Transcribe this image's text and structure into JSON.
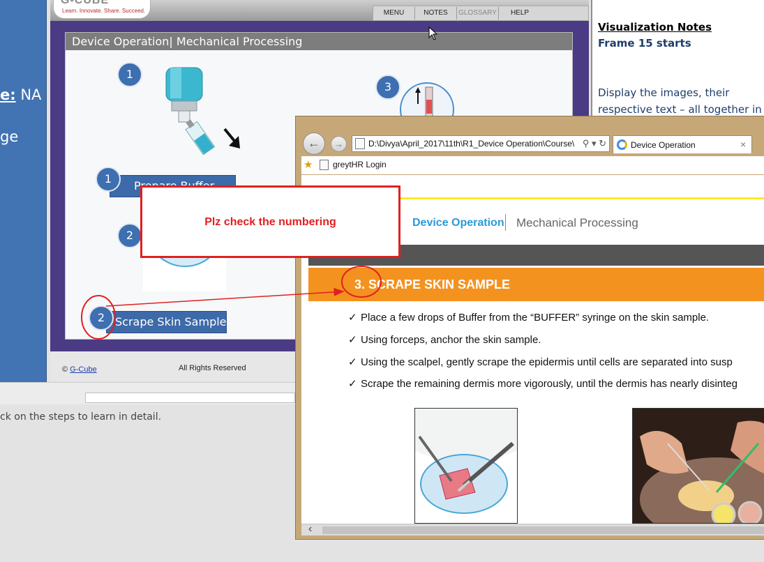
{
  "left_panel": {
    "label_partial": "e:",
    "value": "NA",
    "text_partial": "ge"
  },
  "instruction": "ck on the steps to learn in detail.",
  "course": {
    "logo_text": "G-CUBE",
    "tagline": "Learn. Innovate. Share. Succeed.",
    "nav": {
      "menu": "MENU",
      "notes": "NOTES",
      "glossary": "GLOSSARY",
      "help": "HELP"
    },
    "slide_title": "Device Operation| Mechanical Processing",
    "steps": [
      {
        "number": "1",
        "label": "Prepare Buffer"
      },
      {
        "number": "2",
        "label": "Scrape Skin Sample"
      }
    ],
    "image_numbers": [
      "1",
      "2",
      "3"
    ],
    "footer": {
      "copyright_symbol": "©",
      "copyright_link": "G-Cube",
      "rights": "All Rights Reserved"
    }
  },
  "notes": {
    "heading": "Visualization Notes",
    "frame": "Frame 15 starts",
    "body": "Display the images, their respective text – all together in"
  },
  "browser": {
    "address": "D:\\Divya\\April_2017\\11th\\R1_Device Operation\\Course\\",
    "address_controls": "⚲ ▾ ↻",
    "tab_title": "Device Operation",
    "tab_close": "×",
    "favorite": "greytHR Login",
    "header": {
      "section": "Device Operation",
      "subsection": "Mechanical Processing"
    },
    "step_title": "3. SCRAPE SKIN SAMPLE",
    "bullets": [
      "Place a few drops of Buffer from the “BUFFER” syringe on the skin sample.",
      "Using forceps, anchor the skin sample.",
      "Using the scalpel, gently scrape the epidermis until cells are separated into susp",
      "Scrape the remaining dermis more vigorously, until the dermis has nearly disinteg"
    ]
  },
  "annotation": {
    "callout_text": "Plz check the numbering"
  }
}
